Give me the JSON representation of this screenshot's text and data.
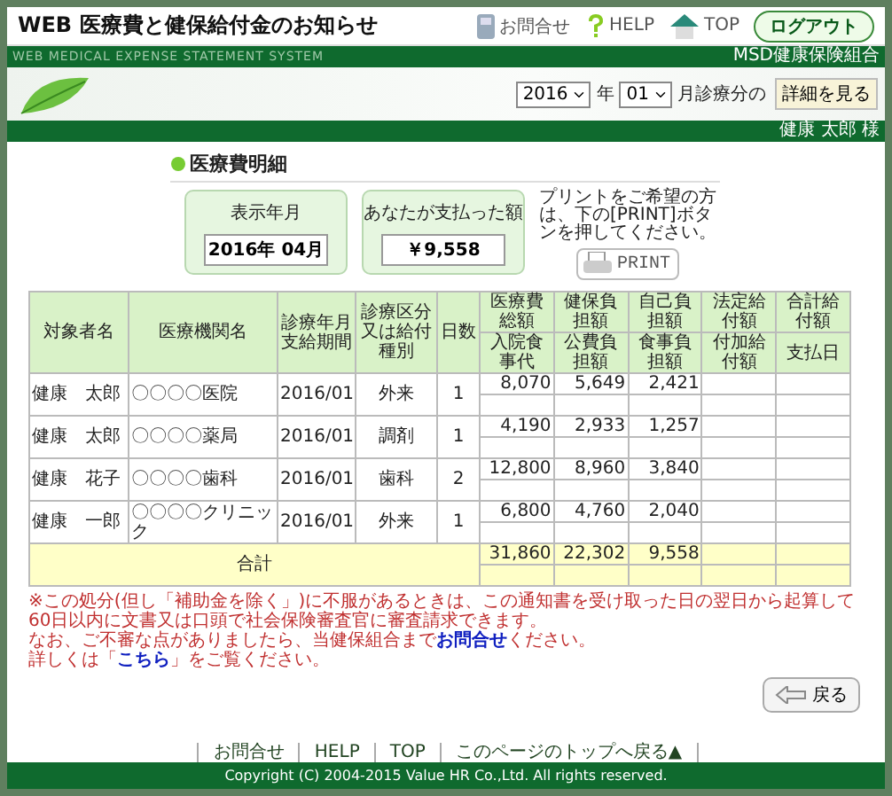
{
  "header": {
    "title": "WEB 医療費と健保給付金のお知らせ",
    "nav": [
      {
        "kind": "phone",
        "label": "お問合せ"
      },
      {
        "kind": "help",
        "label": "HELP"
      },
      {
        "kind": "home",
        "label": "TOP"
      }
    ],
    "logout": "ログアウト"
  },
  "subbar": {
    "left": "WEB MEDICAL EXPENSE STATEMENT SYSTEM",
    "right": "MSD健康保険組合"
  },
  "period": {
    "year": "2016",
    "year_unit": "年",
    "month": "01",
    "month_unit": "月診療分の",
    "button": "詳細を見る"
  },
  "user": "健康 太郎 様",
  "section_title": "医療費明細",
  "summary": [
    {
      "label": "表示年月",
      "value": "2016年 04月"
    },
    {
      "label": "あなたが支払った額",
      "value": "￥9,558"
    }
  ],
  "print": {
    "hint": "プリントをご希望の方は、下の[PRINT]ボタンを押してください。",
    "button": "PRINT"
  },
  "table": {
    "columns": [
      "対象者名",
      "医療機関名",
      "診療年月支給期間",
      "診療区分又は給付種別",
      "日数"
    ],
    "amount_columns_top": [
      "医療費総額",
      "健保負担額",
      "自己負担額",
      "法定給付額",
      "合計給付額"
    ],
    "amount_columns_bottom": [
      "入院食事代",
      "公費負担額",
      "食事負担額",
      "付加給付額",
      "支払日"
    ],
    "rows": [
      {
        "name": "健康　太郎",
        "facility": "〇〇〇〇医院",
        "month": "2016/01",
        "category": "外来",
        "days": "1",
        "amounts": [
          "8,070",
          "5,649",
          "2,421"
        ]
      },
      {
        "name": "健康　太郎",
        "facility": "〇〇〇〇薬局",
        "month": "2016/01",
        "category": "調剤",
        "days": "1",
        "amounts": [
          "4,190",
          "2,933",
          "1,257"
        ]
      },
      {
        "name": "健康　花子",
        "facility": "〇〇〇〇歯科",
        "month": "2016/01",
        "category": "歯科",
        "days": "2",
        "amounts": [
          "12,800",
          "8,960",
          "3,840"
        ]
      },
      {
        "name": "健康　一郎",
        "facility": "〇〇〇〇クリニック",
        "month": "2016/01",
        "category": "外来",
        "days": "1",
        "amounts": [
          "6,800",
          "4,760",
          "2,040"
        ]
      }
    ],
    "total": {
      "label": "合計",
      "amounts": [
        "31,860",
        "22,302",
        "9,558"
      ]
    }
  },
  "notes": {
    "text": "※この処分(但し「補助金を除く」)に不服があるときは、この通知書を受け取った日の翌日から起算して60日以内に文書又は口頭で社会保険審査官に審査請求できます。",
    "contact_before": "なお、ご不審な点がありましたら、当健保組合まで",
    "contact_link": "お問合せ",
    "contact_after": "ください。",
    "detail_before": "詳しくは「",
    "detail_link": "こちら",
    "detail_after": "」をご覧ください。"
  },
  "back_button": "戻る",
  "footer": {
    "links": [
      "お問合せ",
      "HELP",
      "TOP",
      "このページのトップへ戻る▲"
    ],
    "copyright": "Copyright (C) 2004-2015 Value HR Co.,Ltd. All rights reserved."
  }
}
